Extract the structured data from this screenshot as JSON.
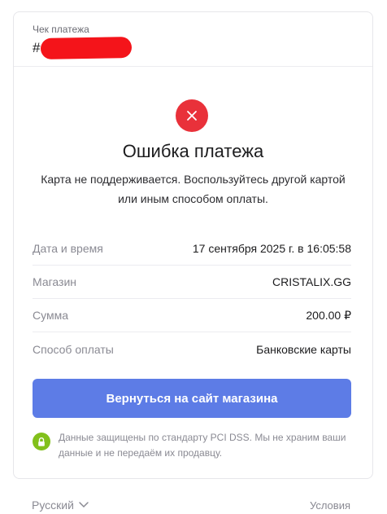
{
  "receipt": {
    "label": "Чек платежа",
    "id_prefix": "#"
  },
  "status": {
    "icon": "close-icon",
    "icon_color": "#e9313a",
    "title": "Ошибка платежа",
    "message": "Карта не поддерживается. Воспользуйтесь другой картой или иным способом оплаты."
  },
  "details": [
    {
      "label": "Дата и время",
      "value": "17 сентября 2025 г. в 16:05:58"
    },
    {
      "label": "Магазин",
      "value": "CRISTALIX.GG"
    },
    {
      "label": "Сумма",
      "value": "200.00 ₽"
    },
    {
      "label": "Способ оплаты",
      "value": "Банковские карты"
    }
  ],
  "return_button": {
    "label": "Вернуться на сайт магазина",
    "color": "#5d7ce6"
  },
  "security": {
    "icon": "lock-icon",
    "icon_color": "#82c01b",
    "text": "Данные защищены по стандарту PCI DSS. Мы не храним ваши данные и не передаём их продавцу."
  },
  "footer": {
    "language": "Русский",
    "terms": "Условия"
  }
}
